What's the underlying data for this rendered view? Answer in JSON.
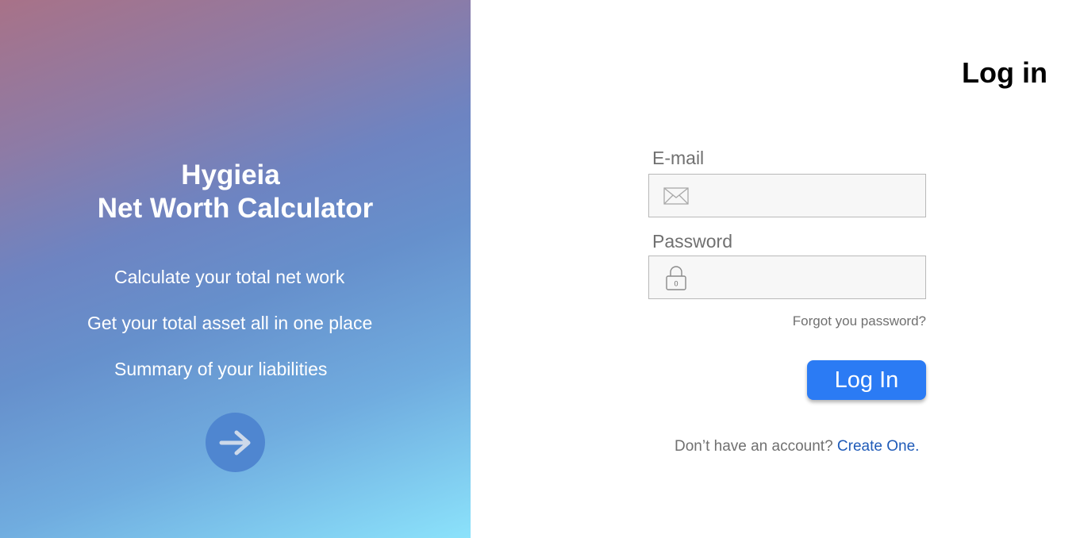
{
  "hero": {
    "title_line1": "Hygieia",
    "title_line2": "Net Worth Calculator",
    "features": [
      "Calculate your total net work",
      "Get your total asset all in one place",
      "Summary of your liabilities"
    ],
    "next_icon": "arrow-right-icon",
    "colors": {
      "gradient_top": "#a87288",
      "gradient_mid": "#6690cc",
      "gradient_bottom": "#8be2fb",
      "button": "#4f86d0"
    }
  },
  "login": {
    "heading": "Log in",
    "email": {
      "label": "E-mail",
      "value": "",
      "icon": "envelope-icon"
    },
    "password": {
      "label": "Password",
      "value": "",
      "icon": "padlock-icon"
    },
    "forgot_link": "Forgot you password?",
    "submit_label": "Log In",
    "signup_prompt": "Don’t have an account?",
    "signup_link": "Create One.",
    "colors": {
      "primary": "#2b7bf4",
      "link": "#1f5bb8"
    }
  }
}
